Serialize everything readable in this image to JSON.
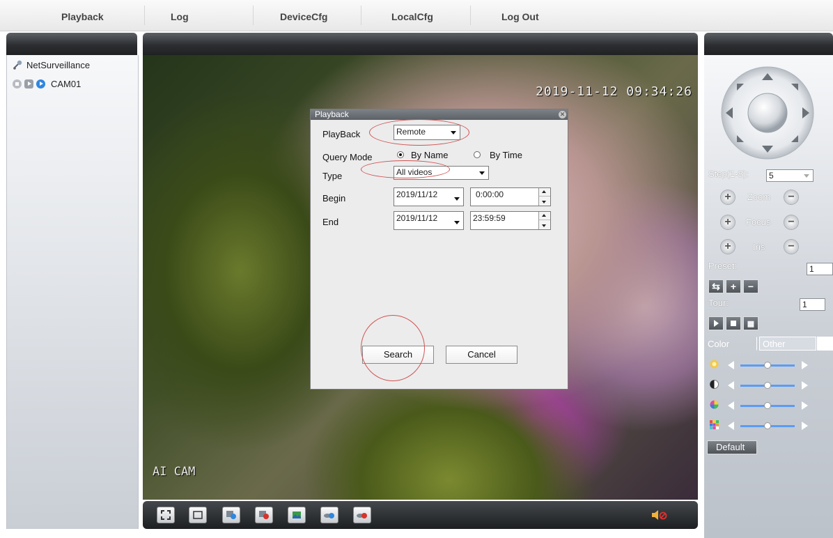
{
  "nav": {
    "items": [
      "Playback",
      "Log",
      "DeviceCfg",
      "LocalCfg",
      "Log Out"
    ]
  },
  "device_tree": {
    "root_label": "NetSurveillance",
    "camera_label": "CAM01"
  },
  "video": {
    "timestamp": "2019-11-12 09:34:26",
    "watermark": "AI CAM"
  },
  "toolbar": {
    "buttons": [
      "fullscreen-icon",
      "window-icon",
      "record-icon",
      "stop-record-icon",
      "snapshot-icon",
      "talk-icon",
      "stop-talk-icon"
    ],
    "audio": "mute-icon"
  },
  "ptz": {
    "step_label": "Step(1-8):",
    "step_value": "5",
    "zoom_label": "Zoom",
    "focus_label": "Focus",
    "iris_label": "Iris",
    "preset_label": "Preset:",
    "preset_value": "1",
    "tour_label": "Tour:",
    "tour_value": "1"
  },
  "image_tabs": [
    "Color",
    "Other"
  ],
  "sliders": [
    {
      "icon": "brightness-icon",
      "value": 0.5
    },
    {
      "icon": "contrast-icon",
      "value": 0.5
    },
    {
      "icon": "saturation-icon",
      "value": 0.5
    },
    {
      "icon": "hue-icon",
      "value": 0.5
    }
  ],
  "default_button": "Default",
  "dialog": {
    "title": "Playback",
    "playback_label": "PlayBack",
    "playback_value": "Remote",
    "query_mode_label": "Query Mode",
    "by_name": "By Name",
    "by_time": "By Time",
    "query_mode_selected": "By Name",
    "type_label": "Type",
    "type_value": "All videos",
    "begin_label": "Begin",
    "begin_date": "2019/11/12",
    "begin_time": "0:00:00",
    "end_label": "End",
    "end_date": "2019/11/12",
    "end_time": "23:59:59",
    "search_button": "Search",
    "cancel_button": "Cancel"
  },
  "colors": {
    "panel_dark": "#2c2e31",
    "slider_track": "#5a9cf5",
    "annotation_ring": "#d25050"
  }
}
